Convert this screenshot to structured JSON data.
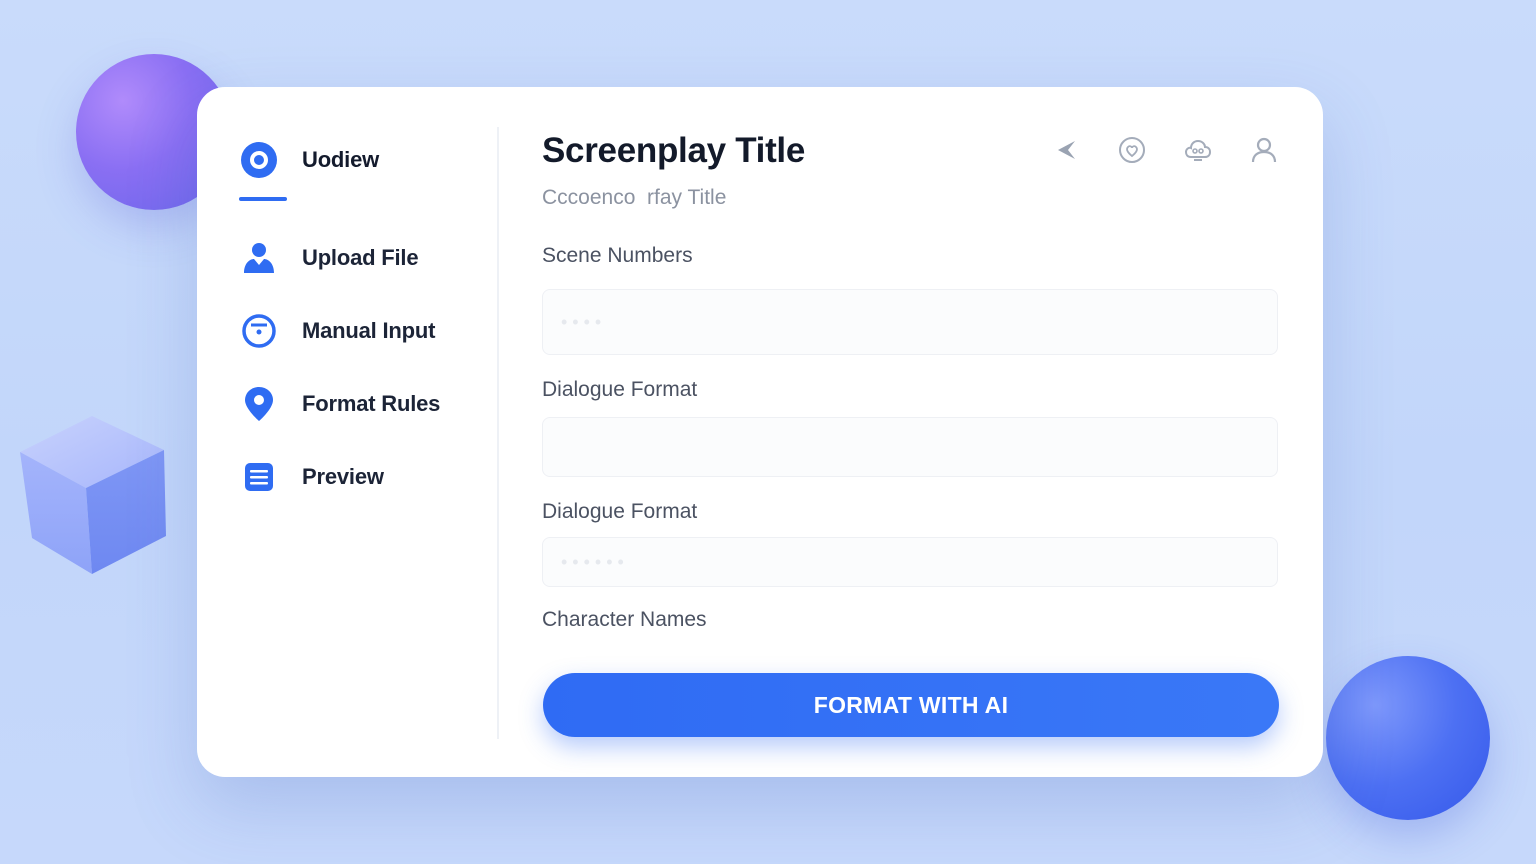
{
  "app": {
    "title": "Screenplay Title",
    "subtitle": "Cccoenco  rfay Title"
  },
  "sidebar": {
    "items": [
      {
        "label": "Uodiew",
        "icon": "circle-dot-icon",
        "active": true
      },
      {
        "label": "Upload File",
        "icon": "user-upload-icon"
      },
      {
        "label": "Manual Input",
        "icon": "circle-input-icon"
      },
      {
        "label": "Format Rules",
        "icon": "map-pin-icon"
      },
      {
        "label": "Preview",
        "icon": "list-icon"
      }
    ]
  },
  "toolbar": {
    "icons": [
      "back-arrow-icon",
      "heart-outline-icon",
      "cloud-icon",
      "profile-icon"
    ]
  },
  "form": {
    "fields": [
      {
        "label": "Scene Numbers",
        "value": "",
        "placeholder": "• • • •"
      },
      {
        "label": "Dialogue Format",
        "value": "",
        "placeholder": ""
      },
      {
        "label": "Dialogue Format",
        "value": "",
        "placeholder": "• • • • • •"
      },
      {
        "label": "Character Names"
      }
    ],
    "submit_label": "FORMAT WITH AI"
  },
  "colors": {
    "accent": "#2f6cf2",
    "background": "#c7d9fb",
    "card": "#ffffff"
  }
}
